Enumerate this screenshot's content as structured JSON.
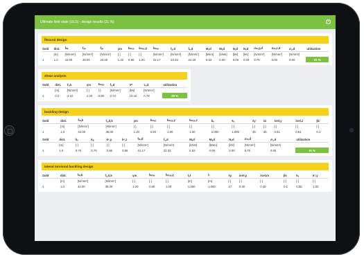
{
  "window": {
    "title": "Ultimate limit state (ULS) - design results (31 %)",
    "close_icon": "×"
  },
  "flexural": {
    "title": "flexural design",
    "headers": [
      "Sold",
      "dist.",
      "fₕₖ",
      "fₑₖ",
      "fₐₖ",
      "γm",
      "kₘₒₑ",
      "kₘₐₓ,y",
      "kₘₒₑ",
      "fₐ,d",
      "fₑ,d",
      "Mₐd",
      "Mₐd",
      "Nₐd",
      "Nₐd",
      "σₘ,y,d",
      "σₘ,z,d",
      "σₐ,d",
      "utilization"
    ],
    "units": [
      "",
      "[m]",
      "[N/mm²]",
      "[N/mm²]",
      "[N/mm²]",
      "[-]",
      "[-]",
      "[-]",
      "[N/mm²]",
      "[N/mm²]",
      "[N/mm²]",
      "[kNm]",
      "[kNm]",
      "[kN]",
      "[kN]",
      "[N/mm²]",
      "[N/mm²]",
      "[N/mm²]",
      ""
    ],
    "row": [
      "1",
      "1.0",
      "44.00",
      "35.00",
      "33.00",
      "1.20",
      "0.80",
      "1.00",
      "31.17",
      "23.33",
      "24.20",
      "6.53",
      "0.00",
      "0.00",
      "0.00",
      "9.79",
      "0.00",
      "0.00",
      "31 %"
    ]
  },
  "shear": {
    "title": "shear analysis",
    "headers": [
      "Sold",
      "dist.",
      "fᵥ,k",
      "γm",
      "kₘₒₑ",
      "fᵥ,d",
      "Vᵈ",
      "τᵥ,d",
      "utilization"
    ],
    "units": [
      "",
      "[m]",
      "[N/mm²]",
      "[-]",
      "[-]",
      "[N/mm²]",
      "[kN]",
      "[N/mm²]",
      ""
    ],
    "row": [
      "1",
      "0.2",
      "4.10",
      "1.20",
      "0.80",
      "2.73",
      "10.44",
      "0.78",
      "29 %"
    ]
  },
  "buckling": {
    "title": "buckling design",
    "t1_headers": [
      "Sold",
      "dist.",
      "fₘ,k",
      "fₐ,0,k",
      "γm",
      "kₘₒₑ",
      "kₘₐₓ,y",
      "kₘₐₓ,z",
      "kₑ",
      "kₐ",
      "λy",
      "λz",
      "λrel,y",
      "λrel,z",
      "βc"
    ],
    "t1_units": [
      "",
      "[m]",
      "[N/mm²]",
      "[N/mm²]",
      "[-]",
      "[-]",
      "[-]",
      "[-]",
      "[-]",
      "[-]",
      "[-]",
      "[-]",
      "[-]",
      "[-]",
      "[-]"
    ],
    "t1_row": [
      "1",
      "1.0",
      "44.00",
      "35.00",
      "1.20",
      "0.80",
      "1.00",
      "1.00",
      "2.000",
      "1.000",
      "35",
      "35",
      "0.61",
      "0.61",
      "0.1"
    ],
    "t2_headers": [
      "Sold",
      "dist.",
      "kᵧ",
      "kᵩ",
      "kᶜ,y",
      "kᶜ,z",
      "fₘ,d",
      "fₐ,d",
      "Mᵧd",
      "Mᵩd",
      "Nₐd",
      "σₘ,d",
      "σₐ,d",
      "utilization"
    ],
    "t2_units": [
      "",
      "[m]",
      "[-]",
      "[-]",
      "[-]",
      "[-]",
      "[N/mm²]",
      "[N/mm²]",
      "[kNm]",
      "[kNm]",
      "[kN]",
      "[N/mm²]",
      "[N/mm²]",
      ""
    ],
    "t2_row": [
      "1",
      "1.0",
      "0.70",
      "0.70",
      "0.96",
      "0.96",
      "31.17",
      "23.33",
      "6.53",
      "0.00",
      "0.00",
      "8.79",
      "0.00",
      "31 %"
    ]
  },
  "lateral": {
    "title": "lateral torsional buckling design",
    "headers": [
      "Sold",
      "dist.",
      "fₘ,k",
      "fₐ,0,k",
      "γm",
      "kₘₒₑ",
      "kₘₐₓ,y",
      "lₑf",
      "lₜ",
      "λy",
      "λrel,y",
      "λrel,m",
      "βc",
      "kᵧ",
      "kᶜ,y"
    ],
    "units": [
      "",
      "[m]",
      "[N/mm²]",
      "[N/mm²]",
      "[-]",
      "[-]",
      "[-]",
      "[m]",
      "[m]",
      "[-]",
      "[-]",
      "[-]",
      "[-]",
      "[-]",
      "[-]"
    ],
    "row": [
      "1",
      "1.0",
      "44.00",
      "35.00",
      "1.20",
      "0.80",
      "1.00",
      "1.000",
      "1.000",
      "17",
      "0.30",
      "0.40",
      "0.1",
      "0.55",
      "1.00"
    ]
  },
  "colors": {
    "accent": "#7dc142",
    "section": "#f6d11c",
    "bezel": "#0f1012"
  }
}
